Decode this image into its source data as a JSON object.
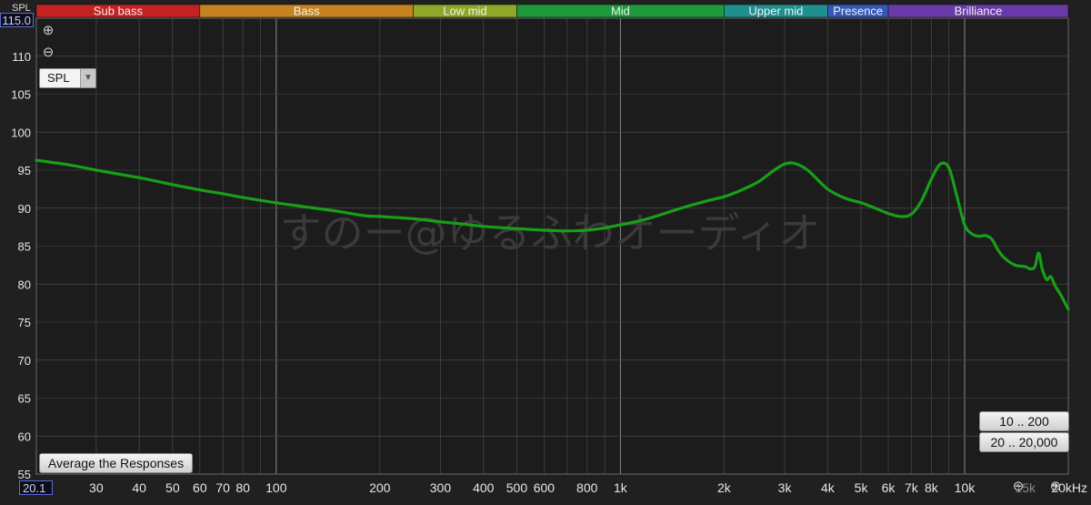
{
  "bands": [
    {
      "label": "Sub bass",
      "from": 20,
      "to": 60,
      "color": "#c42223"
    },
    {
      "label": "Bass",
      "from": 60,
      "to": 250,
      "color": "#c6821e"
    },
    {
      "label": "Low mid",
      "from": 250,
      "to": 500,
      "color": "#8fa82a"
    },
    {
      "label": "Mid",
      "from": 500,
      "to": 2000,
      "color": "#1e9a3c"
    },
    {
      "label": "Upper mid",
      "from": 2000,
      "to": 4000,
      "color": "#1f8f8f"
    },
    {
      "label": "Presence",
      "from": 4000,
      "to": 6000,
      "color": "#3358b8"
    },
    {
      "label": "Brilliance",
      "from": 6000,
      "to": 20000,
      "color": "#6a3ba8"
    }
  ],
  "controls": {
    "zoom_in": "⊕",
    "zoom_out": "⊖",
    "unit_select": "SPL",
    "average_button": "Average the Responses",
    "range_button_1": "10 .. 200",
    "range_button_2": "20 .. 20,000",
    "y_max_value": "115.0",
    "x_min_value": "20.1",
    "y_unit": "SPL",
    "x_zoom_in": "⊖",
    "x_zoom_out": "⊕"
  },
  "watermark": "すのー@ゆるふわオーディオ",
  "colors": {
    "background": "#202020",
    "plot": "#1c1c1c",
    "grid_major": "#8a8a8a",
    "grid_minor": "#444444",
    "curve": "#17a017"
  },
  "chart_data": {
    "type": "line",
    "x_scale": "log",
    "xlim": [
      20.1,
      20000
    ],
    "ylim": [
      55,
      115
    ],
    "ylabel": "SPL",
    "x_ticks": [
      {
        "value": 30,
        "label": "30"
      },
      {
        "value": 40,
        "label": "40"
      },
      {
        "value": 50,
        "label": "50"
      },
      {
        "value": 60,
        "label": "60"
      },
      {
        "value": 70,
        "label": "70"
      },
      {
        "value": 80,
        "label": "80"
      },
      {
        "value": 100,
        "label": "100"
      },
      {
        "value": 200,
        "label": "200"
      },
      {
        "value": 300,
        "label": "300"
      },
      {
        "value": 400,
        "label": "400"
      },
      {
        "value": 500,
        "label": "500"
      },
      {
        "value": 600,
        "label": "600"
      },
      {
        "value": 800,
        "label": "800"
      },
      {
        "value": 1000,
        "label": "1k"
      },
      {
        "value": 2000,
        "label": "2k"
      },
      {
        "value": 3000,
        "label": "3k"
      },
      {
        "value": 4000,
        "label": "4k"
      },
      {
        "value": 5000,
        "label": "5k"
      },
      {
        "value": 6000,
        "label": "6k"
      },
      {
        "value": 7000,
        "label": "7k"
      },
      {
        "value": 8000,
        "label": "8k"
      },
      {
        "value": 10000,
        "label": "10k"
      },
      {
        "value": 15000,
        "label": "15k"
      },
      {
        "value": 20000,
        "label": "20kHz"
      }
    ],
    "y_ticks": [
      55,
      60,
      65,
      70,
      75,
      80,
      85,
      90,
      95,
      100,
      105,
      110
    ],
    "series": [
      {
        "color": "#17a017",
        "points": [
          [
            20.1,
            96.3
          ],
          [
            25,
            95.7
          ],
          [
            30,
            95.0
          ],
          [
            40,
            94.0
          ],
          [
            50,
            93.1
          ],
          [
            60,
            92.4
          ],
          [
            70,
            91.9
          ],
          [
            80,
            91.4
          ],
          [
            100,
            90.7
          ],
          [
            120,
            90.2
          ],
          [
            150,
            89.6
          ],
          [
            180,
            89.0
          ],
          [
            200,
            88.9
          ],
          [
            250,
            88.6
          ],
          [
            300,
            88.2
          ],
          [
            350,
            87.9
          ],
          [
            400,
            87.6
          ],
          [
            500,
            87.3
          ],
          [
            600,
            87.1
          ],
          [
            700,
            87.0
          ],
          [
            800,
            87.1
          ],
          [
            900,
            87.4
          ],
          [
            1000,
            87.8
          ],
          [
            1200,
            88.6
          ],
          [
            1500,
            90.0
          ],
          [
            1800,
            91.0
          ],
          [
            2000,
            91.5
          ],
          [
            2200,
            92.2
          ],
          [
            2500,
            93.4
          ],
          [
            2800,
            95.0
          ],
          [
            3000,
            95.8
          ],
          [
            3200,
            95.9
          ],
          [
            3500,
            95.0
          ],
          [
            4000,
            92.5
          ],
          [
            4500,
            91.3
          ],
          [
            5000,
            90.7
          ],
          [
            5500,
            90.0
          ],
          [
            6000,
            89.3
          ],
          [
            6500,
            88.9
          ],
          [
            7000,
            89.2
          ],
          [
            7500,
            91.0
          ],
          [
            8000,
            93.8
          ],
          [
            8500,
            95.8
          ],
          [
            9000,
            95.3
          ],
          [
            9500,
            91.5
          ],
          [
            10000,
            87.8
          ],
          [
            10500,
            86.6
          ],
          [
            11000,
            86.3
          ],
          [
            11500,
            86.4
          ],
          [
            12000,
            85.9
          ],
          [
            12500,
            84.5
          ],
          [
            13000,
            83.5
          ],
          [
            14000,
            82.5
          ],
          [
            15000,
            82.3
          ],
          [
            15500,
            82.0
          ],
          [
            16000,
            82.3
          ],
          [
            16400,
            84.1
          ],
          [
            16800,
            82.0
          ],
          [
            17300,
            80.6
          ],
          [
            17800,
            81.0
          ],
          [
            18300,
            79.8
          ],
          [
            19000,
            78.6
          ],
          [
            20000,
            76.7
          ]
        ]
      }
    ]
  }
}
